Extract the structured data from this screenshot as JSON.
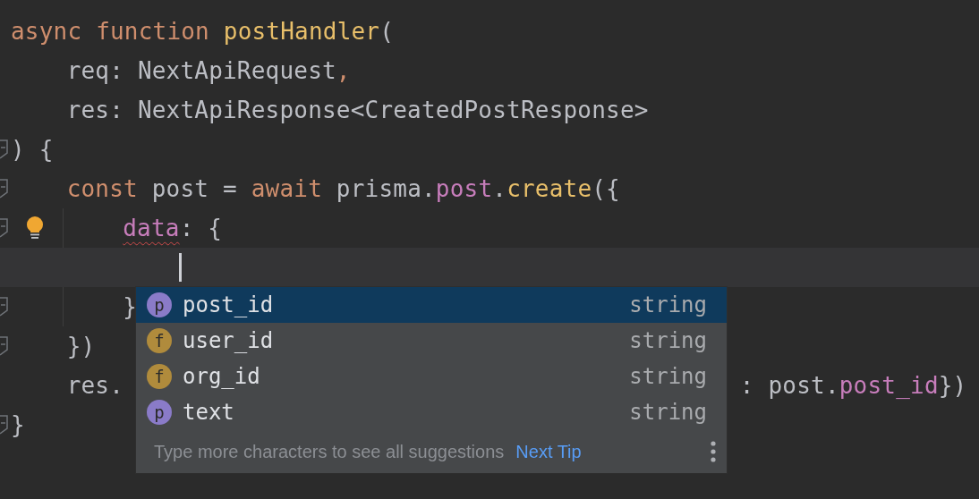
{
  "editor": {
    "lines": [
      {
        "fold": false,
        "bulb": false,
        "cursor": false,
        "tokens": [
          {
            "text": "async ",
            "kind": "keyword"
          },
          {
            "text": "function ",
            "kind": "keyword"
          },
          {
            "text": "postHandler",
            "kind": "function"
          },
          {
            "text": "(",
            "kind": "plain"
          }
        ]
      },
      {
        "fold": false,
        "bulb": false,
        "cursor": false,
        "tokens": [
          {
            "text": "    req: NextApiRequest",
            "kind": "plain"
          },
          {
            "text": ",",
            "kind": "keyword"
          }
        ]
      },
      {
        "fold": false,
        "bulb": false,
        "cursor": false,
        "tokens": [
          {
            "text": "    res: NextApiResponse<CreatedPostResponse>",
            "kind": "plain"
          }
        ]
      },
      {
        "fold": true,
        "bulb": false,
        "cursor": false,
        "tokens": [
          {
            "text": ") {",
            "kind": "plain"
          }
        ]
      },
      {
        "fold": true,
        "bulb": false,
        "cursor": false,
        "tokens": [
          {
            "text": "    const ",
            "kind": "keyword"
          },
          {
            "text": "post = ",
            "kind": "plain"
          },
          {
            "text": "await ",
            "kind": "keyword"
          },
          {
            "text": "prisma.",
            "kind": "plain"
          },
          {
            "text": "post",
            "kind": "property"
          },
          {
            "text": ".",
            "kind": "plain"
          },
          {
            "text": "create",
            "kind": "function"
          },
          {
            "text": "({",
            "kind": "plain"
          }
        ]
      },
      {
        "fold": true,
        "bulb": true,
        "cursor": false,
        "tokens": [
          {
            "text": "        data",
            "kind": "property",
            "error": true
          },
          {
            "text": ": {",
            "kind": "plain"
          }
        ]
      },
      {
        "fold": false,
        "bulb": false,
        "cursor": true
      },
      {
        "fold": true,
        "bulb": false,
        "cursor": false,
        "tokens": [
          {
            "text": "        }",
            "kind": "plain"
          }
        ]
      },
      {
        "fold": true,
        "bulb": false,
        "cursor": false,
        "tokens": [
          {
            "text": "    })",
            "kind": "plain"
          }
        ]
      },
      {
        "fold": false,
        "bulb": false,
        "cursor": false,
        "tokens": [
          {
            "text": "    res.",
            "kind": "plain"
          },
          {
            "text": ": post.",
            "kind": "plain",
            "resumed": true
          },
          {
            "text": "post_id",
            "kind": "property"
          },
          {
            "text": "})",
            "kind": "plain"
          }
        ]
      },
      {
        "fold": true,
        "bulb": false,
        "cursor": false,
        "tokens": [
          {
            "text": "}",
            "kind": "plain"
          }
        ]
      }
    ]
  },
  "completion": {
    "items": [
      {
        "icon": "p",
        "kind": "property",
        "name": "post_id",
        "type": "string",
        "selected": true
      },
      {
        "icon": "f",
        "kind": "field",
        "name": "user_id",
        "type": "string",
        "selected": false
      },
      {
        "icon": "f",
        "kind": "field",
        "name": "org_id",
        "type": "string",
        "selected": false
      },
      {
        "icon": "p",
        "kind": "property",
        "name": "text",
        "type": "string",
        "selected": false
      }
    ],
    "hint": "Type more characters to see all suggestions",
    "link": "Next Tip"
  }
}
